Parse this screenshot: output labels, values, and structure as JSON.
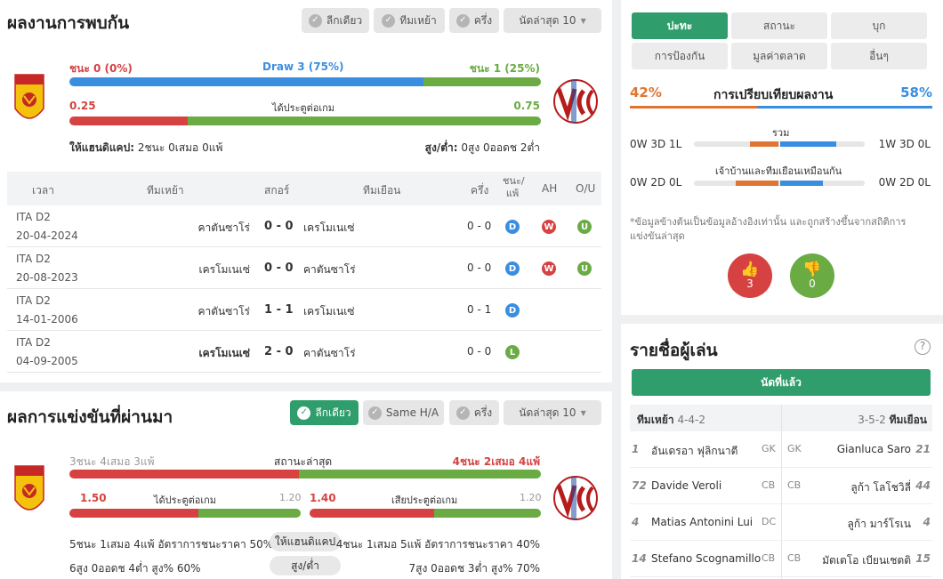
{
  "h2h": {
    "title": "ผลงานการพบกัน",
    "filters": [
      "ลีกเดียว",
      "ทีมเหย้า",
      "ครึ่ง"
    ],
    "recent_select": "นัดล่าสุด 10",
    "win_home": "ชนะ 0 (0%)",
    "draw": "Draw 3 (75%)",
    "win_away": "ชนะ 1 (25%)",
    "result_split": {
      "home": 0,
      "draw": 75,
      "away": 25
    },
    "goals_home": "0.25",
    "goals_label": "ได้ประตูต่อเกม",
    "goals_away": "0.75",
    "goals_split": {
      "home": 25,
      "away": 75
    },
    "handicap_label": "ให้แฮนดิแคป:",
    "handicap_value": "2ชนะ 0เสมอ 0แพ้",
    "ou_label": "สูง/ต่ำ:",
    "ou_value": "0สูง 0ออดช 2ต่ำ",
    "columns": {
      "time": "เวลา",
      "home": "ทีมเหย้า",
      "score": "สกอร์",
      "away": "ทีมเยือน",
      "half": "ครึ่ง",
      "wl": "ชนะ/แพ้",
      "ah": "AH",
      "ou": "O/U"
    },
    "rows": [
      {
        "league": "ITA D2",
        "date": "20-04-2024",
        "home": "คาตันซาโร่",
        "score": "0 - 0",
        "away": "เครโมเนเซ่",
        "half": "0 - 0",
        "wl": "D",
        "ah": "W",
        "ou": "U"
      },
      {
        "league": "ITA D2",
        "date": "20-08-2023",
        "home": "เครโมเนเซ่",
        "score": "0 - 0",
        "away": "คาตันซาโร่",
        "half": "0 - 0",
        "wl": "D",
        "ah": "W",
        "ou": "U"
      },
      {
        "league": "ITA D2",
        "date": "14-01-2006",
        "home": "คาตันซาโร่",
        "score": "1 - 1",
        "away": "เครโมเนเซ่",
        "half": "0 - 1",
        "wl": "D",
        "ah": "",
        "ou": ""
      },
      {
        "league": "ITA D2",
        "date": "04-09-2005",
        "home": "เครโมเนเซ่",
        "score": "2 - 0",
        "away": "คาตันซาโร่",
        "half": "0 - 0",
        "wl": "L",
        "ah": "",
        "ou": ""
      }
    ]
  },
  "recent": {
    "title": "ผลการแข่งขันที่ผ่านมา",
    "filters": [
      "ลีกเดียว",
      "Same H/A",
      "ครึ่ง"
    ],
    "recent_select": "นัดล่าสุด 10",
    "home_form": "3ชนะ 4เสมอ 3แพ้",
    "form_label": "สถานะล่าสุด",
    "away_form": "4ชนะ 2เสมอ 4แพ้",
    "home_scored": "1.50",
    "scored_label": "ได้ประตูต่อเกม",
    "home_conceded_right": "1.20",
    "away_scored": "1.40",
    "conceded_label": "เสียประตูต่อเกม",
    "away_conceded_right": "1.20",
    "home_handicap": "5ชนะ 1เสมอ 4แพ้ อัตราการชนะราคา 50%",
    "handicap_label": "ให้แฮนดิแคป",
    "away_handicap": "4ชนะ 1เสมอ 5แพ้ อัตราการชนะราคา 40%",
    "home_ou": "6สูง 0ออดช 4ต่ำ สูง% 60%",
    "ou_label": "สูง/ต่ำ",
    "away_ou": "7สูง 0ออดช 3ต่ำ สูง% 70%"
  },
  "compare": {
    "tabs": [
      "ปะทะ",
      "สถานะ",
      "บุก",
      "การป้องกัน",
      "มูลค่าตลาด",
      "อื่นๆ"
    ],
    "home_pct": "42%",
    "title": "การเปรียบเทียบผลงาน",
    "away_pct": "58%",
    "total_label": "รวม",
    "total_home": "0W 3D 1L",
    "total_away": "1W 3D 0L",
    "same_label": "เจ้าบ้านและทีมเยือนเหมือนกัน",
    "same_home": "0W 2D 0L",
    "same_away": "0W 2D 0L",
    "note": "*ข้อมูลข้างต้นเป็นข้อมูลอ้างอิงเท่านั้น และถูกสร้างขึ้นจากสถิติการแข่งขันล่าสุด",
    "likes": "3",
    "dislikes": "0"
  },
  "lineup": {
    "title": "รายชื่อผู้เล่น",
    "button": "นัดที่แล้ว",
    "home_label": "ทีมเหย้า",
    "home_formation": "4-4-2",
    "away_formation": "3-5-2",
    "away_label": "ทีมเยือน",
    "home_players": [
      {
        "num": "1",
        "name": "อันเดรอา ฟุลิกนาตี",
        "pos": "GK"
      },
      {
        "num": "72",
        "name": "Davide Veroli",
        "pos": "CB"
      },
      {
        "num": "4",
        "name": "Matias Antonini Lui",
        "pos": "DC"
      },
      {
        "num": "14",
        "name": "Stefano Scognamillo",
        "pos": "CB"
      }
    ],
    "away_players": [
      {
        "num": "21",
        "name": "Gianluca Saro",
        "pos": "GK"
      },
      {
        "num": "44",
        "name": "ลูก้า โลโชวิลี่",
        "pos": "CB"
      },
      {
        "num": "4",
        "name": "ลูก้า มาร์โรเน",
        "pos": ""
      },
      {
        "num": "15",
        "name": "มัตเตโอ เบียนเชตติ",
        "pos": "CB"
      }
    ]
  },
  "colors": {
    "accent": "#2f9e6c",
    "red": "#d64242",
    "blue": "#3a8ee0",
    "green": "#6aab44",
    "orange": "#e07533"
  }
}
